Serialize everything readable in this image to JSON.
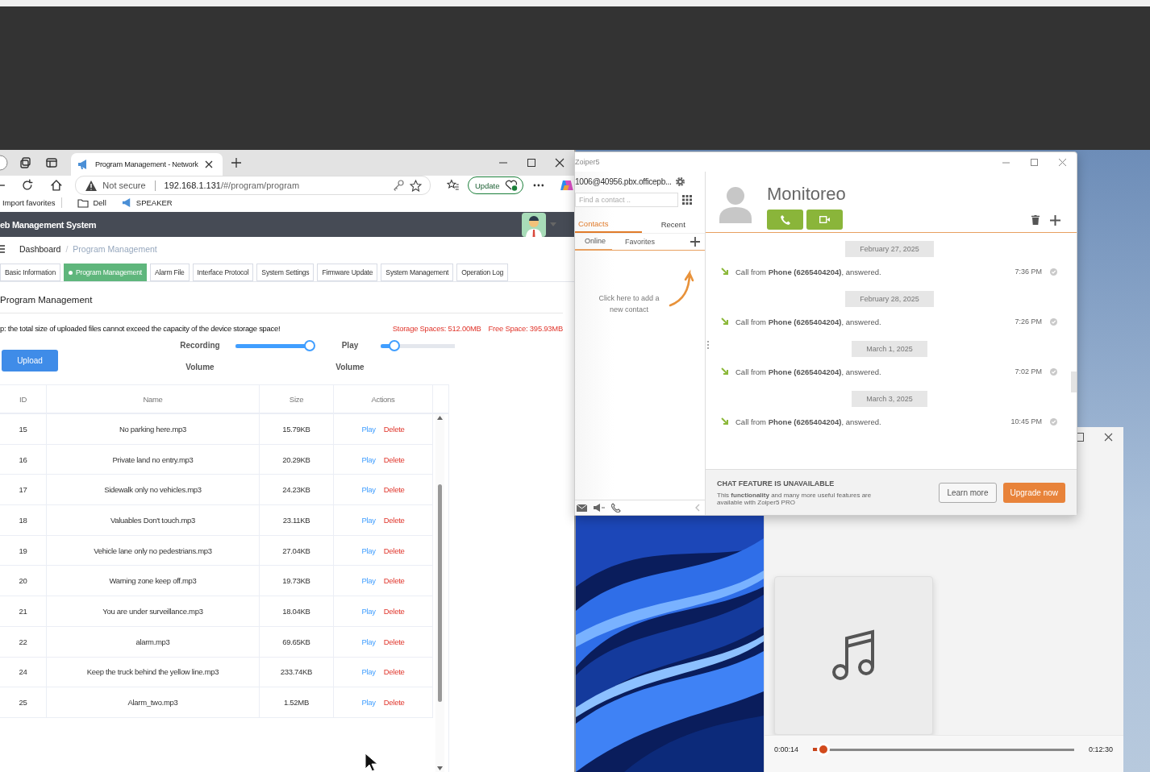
{
  "browser": {
    "tab_title": "Program Management - Network",
    "security": "Not secure",
    "url_host": "192.168.1.131",
    "url_path": "/#/program/program",
    "update_button": "Update",
    "favorites": [
      {
        "label": "Import favorites",
        "kind": "plain"
      },
      {
        "label": "Dell",
        "kind": "folder"
      },
      {
        "label": "SPEAKER",
        "kind": "speaker"
      }
    ]
  },
  "web_app": {
    "title": "eb Management System",
    "breadcrumb_separator": "/",
    "breadcrumb": [
      {
        "label": "Dashboard",
        "current": false
      },
      {
        "label": "Program Management",
        "current": true
      }
    ],
    "tabs": [
      {
        "label": "Basic Information",
        "selected": false
      },
      {
        "label": "Program Management",
        "selected": true
      },
      {
        "label": "Alarm File",
        "selected": false
      },
      {
        "label": "Interface Protocol",
        "selected": false
      },
      {
        "label": "System Settings",
        "selected": false
      },
      {
        "label": "Firmware Update",
        "selected": false
      },
      {
        "label": "System Management",
        "selected": false
      },
      {
        "label": "Operation Log",
        "selected": false
      }
    ],
    "page_title": "Program Management",
    "tip": "p: the total size of uploaded files cannot exceed the capacity of the device storage space!",
    "storage": "Storage Spaces: 512.00MB",
    "free_space": "Free Space: 395.93MB",
    "upload_button": "Upload",
    "sliders": [
      {
        "label": "Recording Volume",
        "level": 0.96
      },
      {
        "label": "Play Volume",
        "level": 0.19
      }
    ],
    "table": {
      "columns": [
        "ID",
        "Name",
        "Size",
        "Actions"
      ],
      "rows": [
        {
          "id": "15",
          "name": "No parking here.mp3",
          "size": "15.79KB",
          "actions": [
            {
              "label": "Play",
              "kind": "play"
            },
            {
              "label": "Delete",
              "kind": "delete"
            }
          ]
        },
        {
          "id": "16",
          "name": "Private land no entry.mp3",
          "size": "20.29KB",
          "actions": [
            {
              "label": "Play",
              "kind": "play"
            },
            {
              "label": "Delete",
              "kind": "delete"
            }
          ]
        },
        {
          "id": "17",
          "name": "Sidewalk only no vehicles.mp3",
          "size": "24.23KB",
          "actions": [
            {
              "label": "Play",
              "kind": "play"
            },
            {
              "label": "Delete",
              "kind": "delete"
            }
          ]
        },
        {
          "id": "18",
          "name": "Valuables Don't touch.mp3",
          "size": "23.11KB",
          "actions": [
            {
              "label": "Play",
              "kind": "play"
            },
            {
              "label": "Delete",
              "kind": "delete"
            }
          ]
        },
        {
          "id": "19",
          "name": "Vehicle lane only no pedestrians.mp3",
          "size": "27.04KB",
          "actions": [
            {
              "label": "Play",
              "kind": "play"
            },
            {
              "label": "Delete",
              "kind": "delete"
            }
          ]
        },
        {
          "id": "20",
          "name": "Warning zone keep off.mp3",
          "size": "19.73KB",
          "actions": [
            {
              "label": "Play",
              "kind": "play"
            },
            {
              "label": "Delete",
              "kind": "delete"
            }
          ]
        },
        {
          "id": "21",
          "name": "You are under surveillance.mp3",
          "size": "18.04KB",
          "actions": [
            {
              "label": "Play",
              "kind": "play"
            },
            {
              "label": "Delete",
              "kind": "delete"
            }
          ]
        },
        {
          "id": "22",
          "name": "alarm.mp3",
          "size": "69.65KB",
          "actions": [
            {
              "label": "Play",
              "kind": "play"
            },
            {
              "label": "Delete",
              "kind": "delete"
            }
          ]
        },
        {
          "id": "24",
          "name": "Keep the truck behind the yellow line.mp3",
          "size": "233.74KB",
          "actions": [
            {
              "label": "Play",
              "kind": "play"
            },
            {
              "label": "Delete",
              "kind": "delete"
            }
          ]
        },
        {
          "id": "25",
          "name": "Alarm_two.mp3",
          "size": "1.52MB",
          "actions": [
            {
              "label": "Play",
              "kind": "play"
            },
            {
              "label": "Delete",
              "kind": "delete"
            }
          ]
        }
      ]
    }
  },
  "softphone": {
    "title": "Zoiper5",
    "account": "1006@40956.pbx.officepb...",
    "search_placeholder": "Find a contact ..",
    "tabs": [
      {
        "label": "Contacts",
        "selected": true
      },
      {
        "label": "Recent",
        "selected": false
      }
    ],
    "filters": [
      {
        "label": "Online",
        "selected": true
      },
      {
        "label": "Favorites",
        "selected": false
      }
    ],
    "empty_hint": "Click here to add a new contact",
    "contact_name": "Monitoreo",
    "history": [
      {
        "date": "February 27, 2025",
        "text": "Call from **Phone (6265404204)**, answered.",
        "time": "7:36 PM"
      },
      {
        "date": "February 28, 2025",
        "text": "Call from **Phone (6265404204)**, answered.",
        "time": "7:26 PM"
      },
      {
        "date": "March 1, 2025",
        "text": "Call from **Phone (6265404204)**, answered.",
        "time": "7:02 PM"
      },
      {
        "date": "March 3, 2025",
        "text": "Call from **Phone (6265404204)**, answered.",
        "time": "10:45 PM"
      }
    ],
    "banner": {
      "title": "CHAT FEATURE IS UNAVAILABLE",
      "text": "This **functionality** and many more useful features are available with Zoiper5 PRO",
      "learn_more": "Learn more",
      "upgrade": "Upgrade now"
    }
  },
  "player": {
    "elapsed": "0:00:14",
    "total": "0:12:30",
    "level": 0.04
  }
}
